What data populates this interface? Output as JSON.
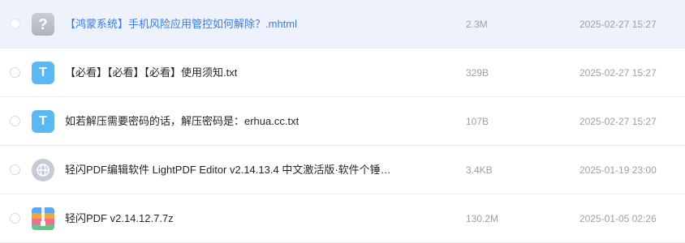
{
  "files": [
    {
      "name": "【鸿蒙系统】手机风险应用管控如何解除？.mhtml",
      "size": "2.3M",
      "date": "2025-02-27 15:27",
      "icon": "unknown-file-icon",
      "icon_glyph": "?",
      "selected": true
    },
    {
      "name": "【必看】【必看】【必看】使用须知.txt",
      "size": "329B",
      "date": "2025-02-27 15:27",
      "icon": "text-file-icon",
      "icon_glyph": "T",
      "selected": false
    },
    {
      "name": "如若解压需要密码的话，解压密码是：erhua.cc.txt",
      "size": "107B",
      "date": "2025-02-27 15:27",
      "icon": "text-file-icon",
      "icon_glyph": "T",
      "selected": false
    },
    {
      "name": "轻闪PDF编辑软件 LightPDF Editor v2.14.13.4 中文激活版·软件个锤…",
      "size": "3.4KB",
      "date": "2025-01-19 23:00",
      "icon": "web-link-icon",
      "selected": false
    },
    {
      "name": "轻闪PDF v2.14.12.7.7z",
      "size": "130.2M",
      "date": "2025-01-05 02:26",
      "icon": "archive-file-icon",
      "selected": false
    }
  ],
  "colors": {
    "selected_row_bg": "#eef2fc",
    "selected_text": "#3a7bea",
    "txt_icon": "#5bb8f0",
    "muted_text": "#9aa0aa"
  }
}
